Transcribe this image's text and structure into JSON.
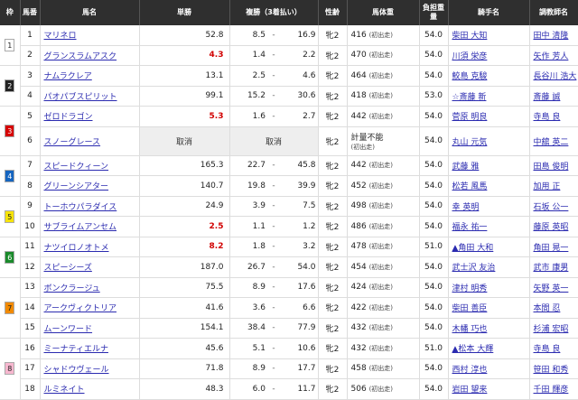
{
  "headers": {
    "waku": "枠",
    "umaban": "馬番",
    "name": "馬名",
    "win": "単勝",
    "place": "複勝（3着払い）",
    "sexage": "性齢",
    "weight": "馬体重",
    "load": "負担重量",
    "jockey": "騎手名",
    "trainer": "調教師名"
  },
  "colors": {
    "waku1": "#ffffff",
    "waku2": "#222222",
    "waku3": "#d60000",
    "waku4": "#1565c0",
    "waku5": "#f6e30a",
    "waku6": "#1a8a2b",
    "waku7": "#f28a00",
    "waku8": "#f7b7cf",
    "favorite": "#d10000",
    "link": "#2b2bb0"
  },
  "rows": [
    {
      "waku": "1",
      "umaban": "1",
      "name": "マリネロ",
      "win": "52.8",
      "fav": false,
      "plo": "8.5",
      "phi": "16.9",
      "sexage": "牝2",
      "weight": "416",
      "weight_note": "(初出走)",
      "load": "54.0",
      "jockey": "柴田 大知",
      "trainer": "田中 清隆"
    },
    {
      "waku": "",
      "umaban": "2",
      "name": "グランスラムアスク",
      "win": "4.3",
      "fav": true,
      "plo": "1.4",
      "phi": "2.2",
      "sexage": "牝2",
      "weight": "470",
      "weight_note": "(初出走)",
      "load": "54.0",
      "jockey": "川須 栄彦",
      "trainer": "矢作 芳人"
    },
    {
      "waku": "2",
      "umaban": "3",
      "name": "ナムラクレア",
      "win": "13.1",
      "fav": false,
      "plo": "2.5",
      "phi": "4.6",
      "sexage": "牝2",
      "weight": "464",
      "weight_note": "(初出走)",
      "load": "54.0",
      "jockey": "鮫島 克駿",
      "trainer": "長谷川 浩大"
    },
    {
      "waku": "",
      "umaban": "4",
      "name": "パオパブスピリット",
      "win": "99.1",
      "fav": false,
      "plo": "15.2",
      "phi": "30.6",
      "sexage": "牝2",
      "weight": "418",
      "weight_note": "(初出走)",
      "load": "53.0",
      "jockey": "☆斎藤 新",
      "trainer": "斎藤 誠"
    },
    {
      "waku": "3",
      "umaban": "5",
      "name": "ゼロドラゴン",
      "win": "5.3",
      "fav": true,
      "plo": "1.6",
      "phi": "2.7",
      "sexage": "牝2",
      "weight": "442",
      "weight_note": "(初出走)",
      "load": "54.0",
      "jockey": "菅原 明良",
      "trainer": "寺島 良"
    },
    {
      "waku": "",
      "umaban": "6",
      "name": "スノーグレース",
      "win": "取消",
      "cancel": true,
      "place_cancel": "取消",
      "sexage": "牝2",
      "weight": "計量不能",
      "weight_note": "(初出走)",
      "load": "54.0",
      "jockey": "丸山 元気",
      "trainer": "中舘 英二"
    },
    {
      "waku": "4",
      "umaban": "7",
      "name": "スピードクィーン",
      "win": "165.3",
      "fav": false,
      "plo": "22.7",
      "phi": "45.8",
      "sexage": "牝2",
      "weight": "442",
      "weight_note": "(初出走)",
      "load": "54.0",
      "jockey": "武藤 雅",
      "trainer": "田島 俊明"
    },
    {
      "waku": "",
      "umaban": "8",
      "name": "グリーンシアター",
      "win": "140.7",
      "fav": false,
      "plo": "19.8",
      "phi": "39.9",
      "sexage": "牝2",
      "weight": "452",
      "weight_note": "(初出走)",
      "load": "54.0",
      "jockey": "松若 風馬",
      "trainer": "加用 正"
    },
    {
      "waku": "5",
      "umaban": "9",
      "name": "トーホウパラダイス",
      "win": "24.9",
      "fav": false,
      "plo": "3.9",
      "phi": "7.5",
      "sexage": "牝2",
      "weight": "498",
      "weight_note": "(初出走)",
      "load": "54.0",
      "jockey": "幸 英明",
      "trainer": "石坂 公一"
    },
    {
      "waku": "",
      "umaban": "10",
      "name": "サブライムアンセム",
      "win": "2.5",
      "fav": true,
      "plo": "1.1",
      "phi": "1.2",
      "sexage": "牝2",
      "weight": "486",
      "weight_note": "(初出走)",
      "load": "54.0",
      "jockey": "福永 祐一",
      "trainer": "藤原 英昭"
    },
    {
      "waku": "6",
      "umaban": "11",
      "name": "ナツイロノオトメ",
      "win": "8.2",
      "fav": true,
      "plo": "1.8",
      "phi": "3.2",
      "sexage": "牝2",
      "weight": "478",
      "weight_note": "(初出走)",
      "load": "51.0",
      "jockey": "▲角田 大和",
      "trainer": "角田 晃一"
    },
    {
      "waku": "",
      "umaban": "12",
      "name": "スピーシーズ",
      "win": "187.0",
      "fav": false,
      "plo": "26.7",
      "phi": "54.0",
      "sexage": "牝2",
      "weight": "454",
      "weight_note": "(初出走)",
      "load": "54.0",
      "jockey": "武士沢 友治",
      "trainer": "武市 康男"
    },
    {
      "waku": "7",
      "umaban": "13",
      "name": "ボンクラージュ",
      "win": "75.5",
      "fav": false,
      "plo": "8.9",
      "phi": "17.6",
      "sexage": "牝2",
      "weight": "424",
      "weight_note": "(初出走)",
      "load": "54.0",
      "jockey": "津村 明秀",
      "trainer": "矢野 英一"
    },
    {
      "waku": "",
      "umaban": "14",
      "name": "アークヴィクトリア",
      "win": "41.6",
      "fav": false,
      "plo": "3.6",
      "phi": "6.6",
      "sexage": "牝2",
      "weight": "422",
      "weight_note": "(初出走)",
      "load": "54.0",
      "jockey": "柴田 善臣",
      "trainer": "本間 忍"
    },
    {
      "waku": "",
      "umaban": "15",
      "name": "ムーンワード",
      "win": "154.1",
      "fav": false,
      "plo": "38.4",
      "phi": "77.9",
      "sexage": "牝2",
      "weight": "432",
      "weight_note": "(初出走)",
      "load": "54.0",
      "jockey": "木幡 巧也",
      "trainer": "杉浦 宏昭"
    },
    {
      "waku": "8",
      "umaban": "16",
      "name": "ミーナティエルナ",
      "win": "45.6",
      "fav": false,
      "plo": "5.1",
      "phi": "10.6",
      "sexage": "牝2",
      "weight": "432",
      "weight_note": "(初出走)",
      "load": "51.0",
      "jockey": "▲松本 大輝",
      "trainer": "寺島 良"
    },
    {
      "waku": "",
      "umaban": "17",
      "name": "シャドウヴェール",
      "win": "71.8",
      "fav": false,
      "plo": "8.9",
      "phi": "17.7",
      "sexage": "牝2",
      "weight": "458",
      "weight_note": "(初出走)",
      "load": "54.0",
      "jockey": "西村 淳也",
      "trainer": "笹田 和秀"
    },
    {
      "waku": "",
      "umaban": "18",
      "name": "ルミネイト",
      "win": "48.3",
      "fav": false,
      "plo": "6.0",
      "phi": "11.7",
      "sexage": "牝2",
      "weight": "506",
      "weight_note": "(初出走)",
      "load": "54.0",
      "jockey": "岩田 望来",
      "trainer": "千田 輝彦"
    }
  ]
}
